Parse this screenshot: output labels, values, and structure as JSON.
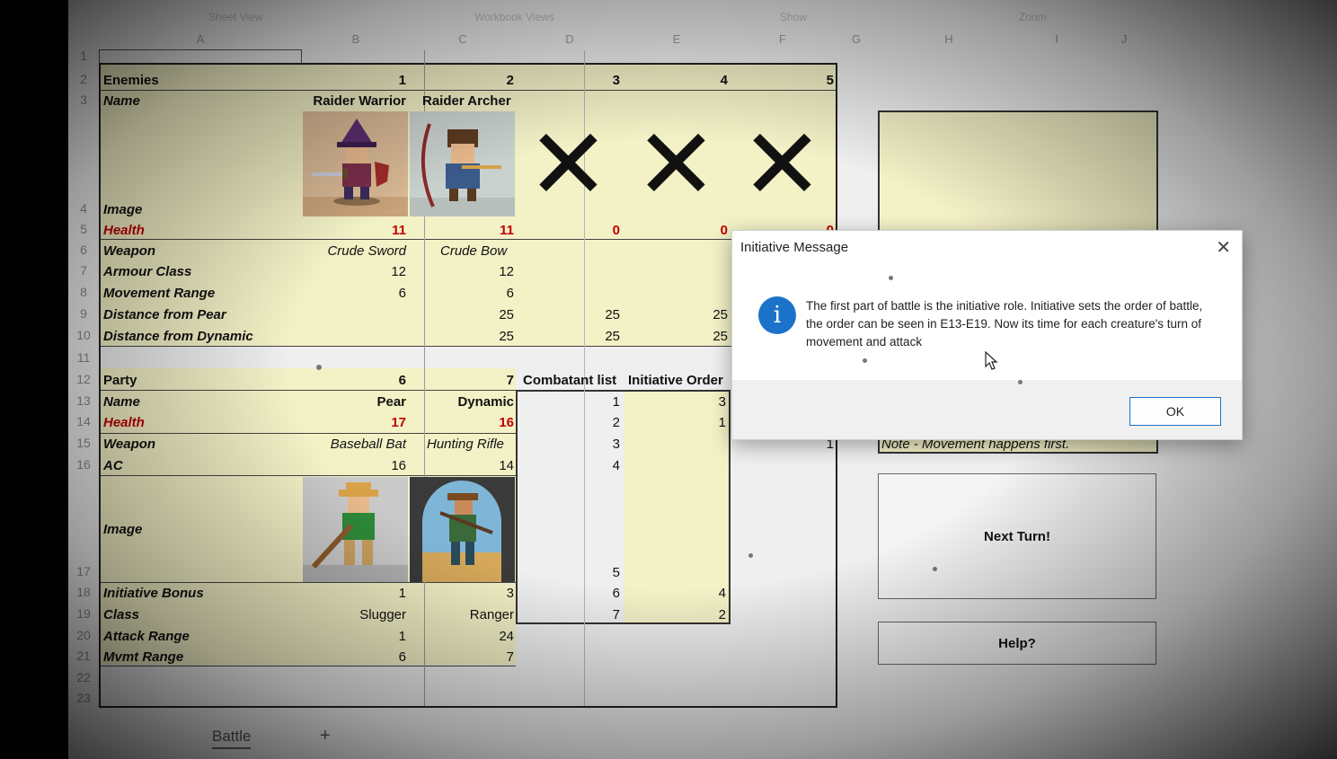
{
  "ribbon": {
    "group1": "Sheet View",
    "group2": "Workbook Views",
    "group3": "Show",
    "group4": "Zoom"
  },
  "columns": [
    "A",
    "B",
    "C",
    "D",
    "E",
    "F",
    "G",
    "H",
    "I",
    "J"
  ],
  "rows": [
    "1",
    "2",
    "3",
    "4",
    "5",
    "6",
    "7",
    "8",
    "9",
    "10",
    "11",
    "12",
    "13",
    "14",
    "15",
    "16",
    "17",
    "18",
    "19",
    "20",
    "21",
    "22",
    "23"
  ],
  "enemies": {
    "header": "Enemies",
    "slots": [
      "1",
      "2",
      "3",
      "4",
      "5"
    ],
    "name_label": "Name",
    "names": [
      "Raider Warrior",
      "Raider Archer"
    ],
    "image_label": "Image",
    "health_label": "Health",
    "health": [
      "11",
      "11",
      "0",
      "0",
      "0"
    ],
    "weapon_label": "Weapon",
    "weapons": [
      "Crude Sword",
      "Crude Bow"
    ],
    "ac_label": "Armour Class",
    "ac": [
      "12",
      "12"
    ],
    "move_label": "Movement Range",
    "move": [
      "6",
      "6"
    ],
    "dist_pear_label": "Distance from Pear",
    "dist_pear": [
      "25",
      "25",
      "25"
    ],
    "dist_dyn_label": "Distance from Dynamic",
    "dist_dyn": [
      "25",
      "25",
      "25"
    ]
  },
  "party": {
    "header": "Party",
    "slots": [
      "6",
      "7"
    ],
    "name_label": "Name",
    "names": [
      "Pear",
      "Dynamic"
    ],
    "health_label": "Health",
    "health": [
      "17",
      "16"
    ],
    "weapon_label": "Weapon",
    "weapons": [
      "Baseball Bat",
      "Hunting Rifle"
    ],
    "ac_label": "AC",
    "ac": [
      "16",
      "14"
    ],
    "image_label": "Image",
    "init_label": "Initiative Bonus",
    "init": [
      "1",
      "3"
    ],
    "class_label": "Class",
    "classes": [
      "Slugger",
      "Ranger"
    ],
    "attack_label": "Attack Range",
    "attack": [
      "1",
      "24"
    ],
    "mvmt_label": "Mvmt Range",
    "mvmt": [
      "6",
      "7"
    ]
  },
  "order": {
    "combatant_header": "Combatant list",
    "initiative_header": "Initiative Order",
    "combatants": [
      "1",
      "2",
      "3",
      "4",
      "5",
      "6",
      "7"
    ],
    "initiative": [
      "3",
      "1",
      "",
      "",
      "",
      "4",
      "2"
    ]
  },
  "panel": {
    "stray_value": "1",
    "note": "Note - Movement happens first.",
    "next_turn": "Next Turn!",
    "help": "Help?"
  },
  "tabs": {
    "sheet": "Battle",
    "add": "+"
  },
  "dialog": {
    "title": "Initiative Message",
    "message": "The first part of battle is the initiative role. Initiative sets the order of battle, the order can be seen in E13-E19. Now its time for each creature's turn of movement and attack",
    "ok": "OK",
    "info_glyph": "i",
    "close_glyph": "✕"
  },
  "colors": {
    "cell_fill": "#f3f1c6",
    "health_red": "#c00000",
    "accent": "#1b73c9"
  }
}
